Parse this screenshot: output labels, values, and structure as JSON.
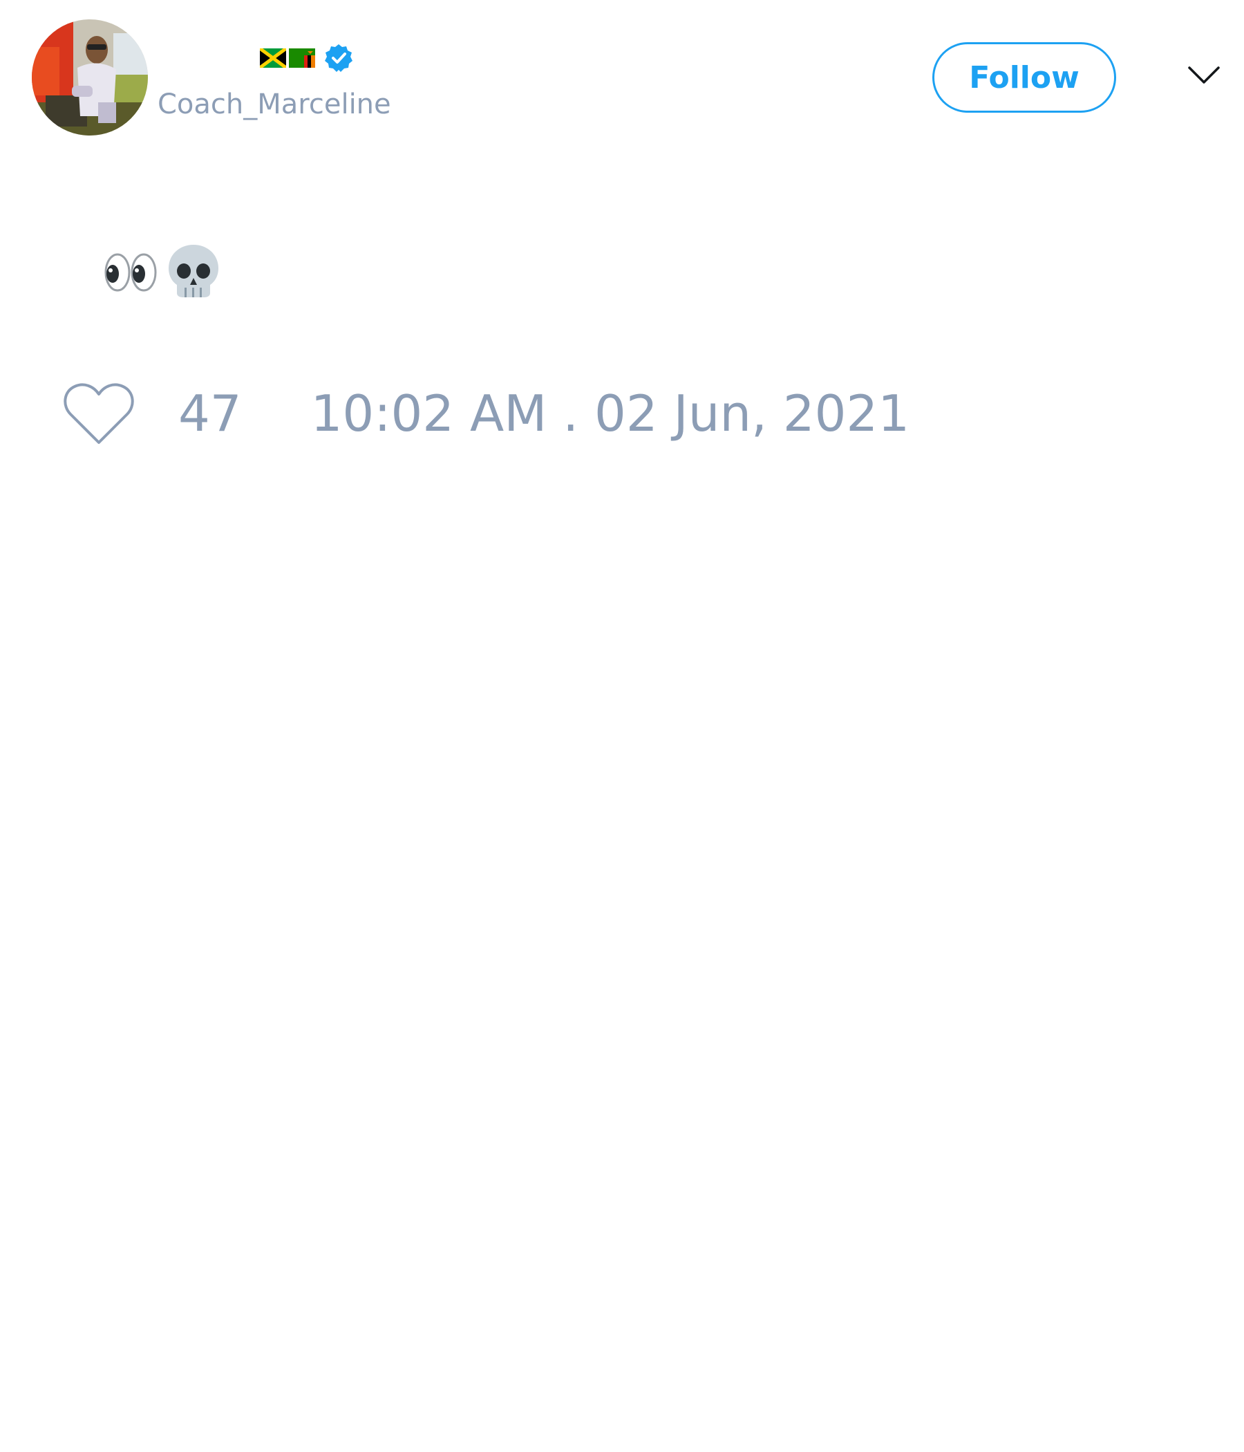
{
  "tweet": {
    "author": {
      "handle": "Coach_Marceline",
      "display_flags": [
        "flag-jamaica-icon",
        "flag-zambia-icon"
      ],
      "verified": true
    },
    "text_emoji": [
      "eyes-emoji",
      "skull-emoji"
    ],
    "like_count": "47",
    "timestamp": "10:02 AM . 02 Jun, 2021"
  },
  "actions": {
    "follow_label": "Follow"
  },
  "colors": {
    "accent": "#1da1f2",
    "muted_text": "#8c9db5",
    "background": "#ffffff"
  },
  "icons": {
    "heart": "heart-icon",
    "menu": "chevron-down-icon",
    "verified": "verified-badge-icon"
  }
}
